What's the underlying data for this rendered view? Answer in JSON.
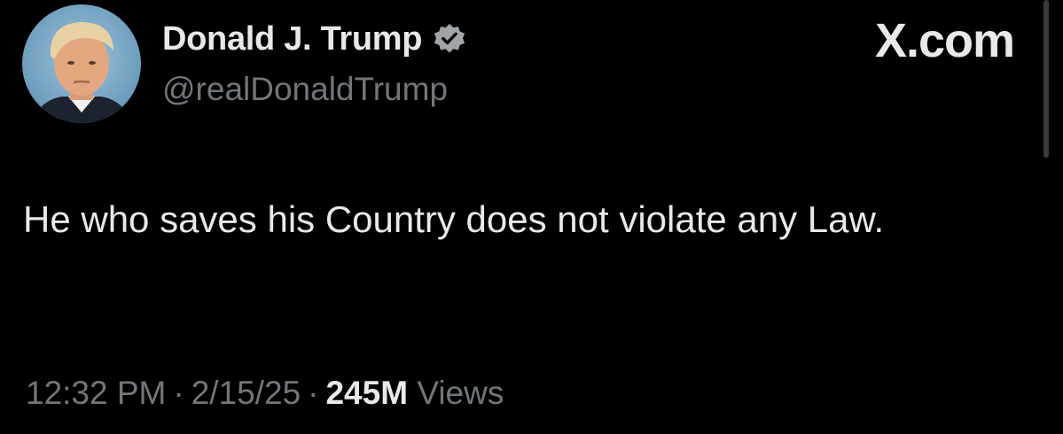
{
  "author": {
    "display_name": "Donald J. Trump",
    "handle": "@realDonaldTrump",
    "verified": true,
    "verified_color": "#a0a5aa"
  },
  "brand": {
    "label": "X.com"
  },
  "tweet": {
    "text": "He who saves his Country does not violate any Law."
  },
  "meta": {
    "time": "12:32 PM",
    "separator": "·",
    "date": "2/15/25",
    "views_count": "245M",
    "views_label": "Views"
  },
  "colors": {
    "background": "#000000",
    "primary_text": "#e7e9ea",
    "secondary_text": "#71767b"
  }
}
